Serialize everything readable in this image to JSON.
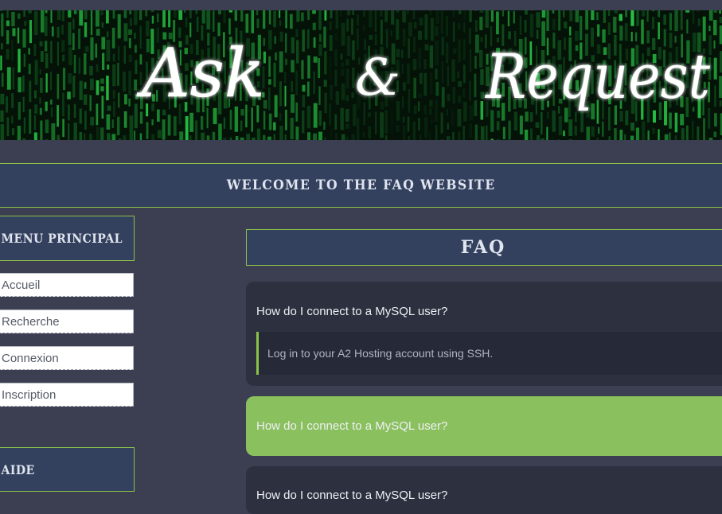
{
  "banner": {
    "title_part1": "Ask",
    "ampersand": "&",
    "title_part2": "Request"
  },
  "welcome": {
    "text": "Welcome to the FAQ website"
  },
  "sidebar": {
    "menu_title": "Menu Principal",
    "items": [
      {
        "label": "Accueil"
      },
      {
        "label": "Recherche"
      },
      {
        "label": "Connexion"
      },
      {
        "label": "Inscription"
      }
    ],
    "help_title": "Aide"
  },
  "faq": {
    "title": "FAQ",
    "items": [
      {
        "question": "How do I connect to a MySQL user?",
        "answer": "Log in to your A2 Hosting account using SSH.",
        "expanded": true
      },
      {
        "question": "How do I connect to a MySQL user?",
        "highlighted": true
      },
      {
        "question": "How do I connect to a MySQL user?"
      }
    ]
  },
  "colors": {
    "accent": "#8bc34a",
    "panel": "#34415e",
    "background": "#3c3f52",
    "card": "#2c303f"
  }
}
